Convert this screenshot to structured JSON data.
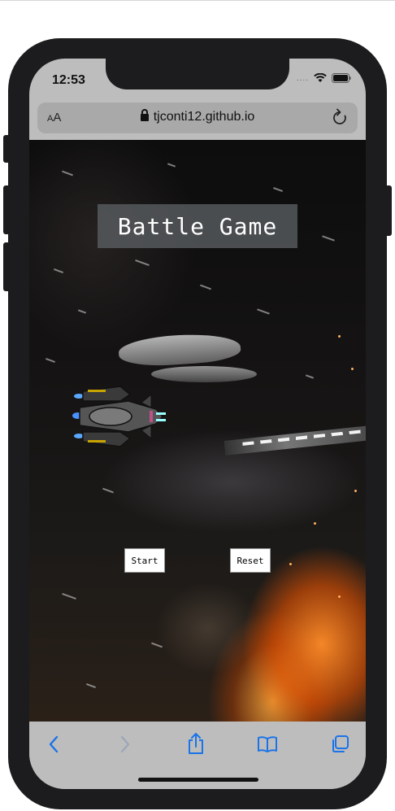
{
  "status": {
    "time": "12:53",
    "signal_dots": "...."
  },
  "browser": {
    "text_size_label_small": "A",
    "text_size_label_large": "A",
    "url": "tjconti12.github.io"
  },
  "game": {
    "title": "Battle Game",
    "start_label": "Start",
    "reset_label": "Reset"
  },
  "toolbar": {
    "icons": [
      "back-icon",
      "forward-icon",
      "share-icon",
      "bookmarks-icon",
      "tabs-icon"
    ]
  },
  "colors": {
    "accent": "#1a73e8",
    "device": "#1c1c1e",
    "title_box": "#585c5f"
  }
}
